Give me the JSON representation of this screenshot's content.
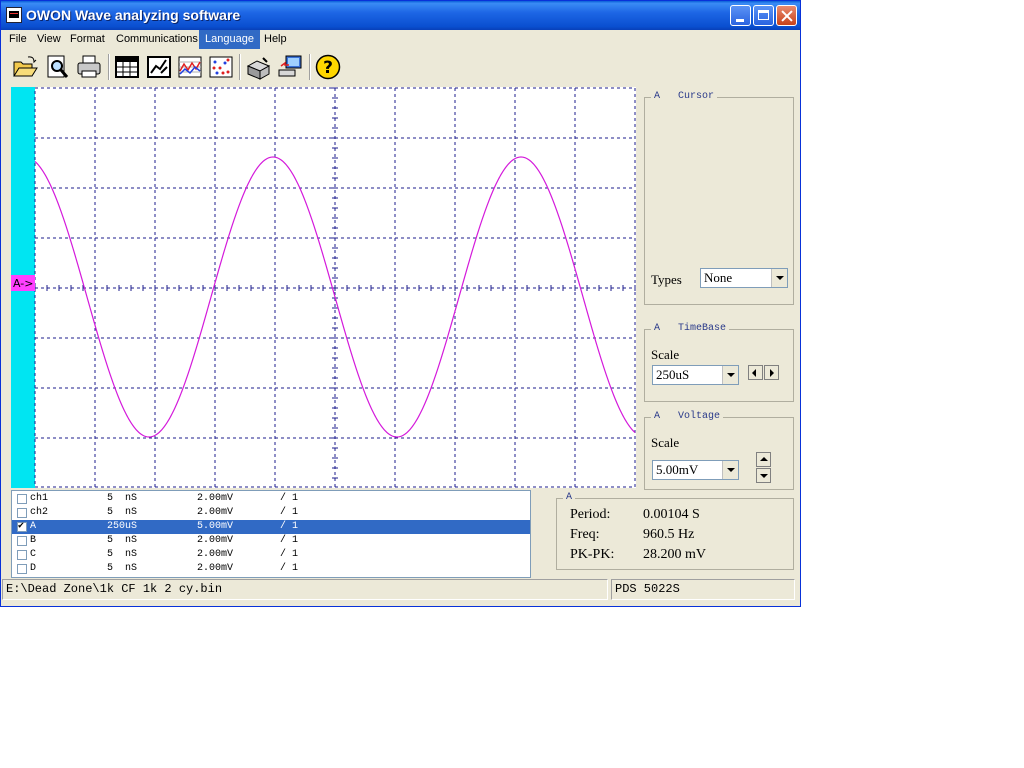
{
  "window": {
    "title": "OWON Wave analyzing software"
  },
  "menu": [
    "File",
    "View",
    "Format",
    "Communications",
    "Language",
    "Help"
  ],
  "toolbar": {
    "icons": [
      "open-folder-icon",
      "print-preview-icon",
      "print-icon",
      "table-icon",
      "chart-edit-icon",
      "waveform-icon",
      "scatter-icon",
      "device-icon",
      "computer-transfer-icon",
      "help-icon"
    ]
  },
  "scope": {
    "marker_label": "A->",
    "trace_color": "#d41adb",
    "grid_color": "#1c1c8c",
    "side_bar_color": "#00e5f2",
    "marker_color": "#ff40ff"
  },
  "cursor_panel": {
    "legend": "A   Cursor",
    "types_label": "Types",
    "types_value": "None"
  },
  "timebase_panel": {
    "legend": "A   TimeBase",
    "scale_label": "Scale",
    "scale_value": "250uS"
  },
  "voltage_panel": {
    "legend": "A   Voltage",
    "scale_label": "Scale",
    "scale_value": "5.00mV"
  },
  "channels": [
    {
      "name": "ch1",
      "time": "5  nS",
      "volt": "2.00mV",
      "ratio": "/ 1",
      "checked": false,
      "selected": false
    },
    {
      "name": "ch2",
      "time": "5  nS",
      "volt": "2.00mV",
      "ratio": "/ 1",
      "checked": false,
      "selected": false
    },
    {
      "name": "A",
      "time": "250uS",
      "volt": "5.00mV",
      "ratio": "/ 1",
      "checked": true,
      "selected": true
    },
    {
      "name": "B",
      "time": "5  nS",
      "volt": "2.00mV",
      "ratio": "/ 1",
      "checked": false,
      "selected": false
    },
    {
      "name": "C",
      "time": "5  nS",
      "volt": "2.00mV",
      "ratio": "/ 1",
      "checked": false,
      "selected": false
    },
    {
      "name": "D",
      "time": "5  nS",
      "volt": "2.00mV",
      "ratio": "/ 1",
      "checked": false,
      "selected": false
    }
  ],
  "measure": {
    "legend": "A",
    "period_label": "Period:",
    "period_value": "0.00104 S",
    "freq_label": "Freq:",
    "freq_value": "960.5 Hz",
    "pkpk_label": "PK-PK:",
    "pkpk_value": "28.200 mV"
  },
  "status": {
    "file": "E:\\Dead Zone\\1k CF 1k 2 cy.bin",
    "device": "PDS 5022S"
  }
}
